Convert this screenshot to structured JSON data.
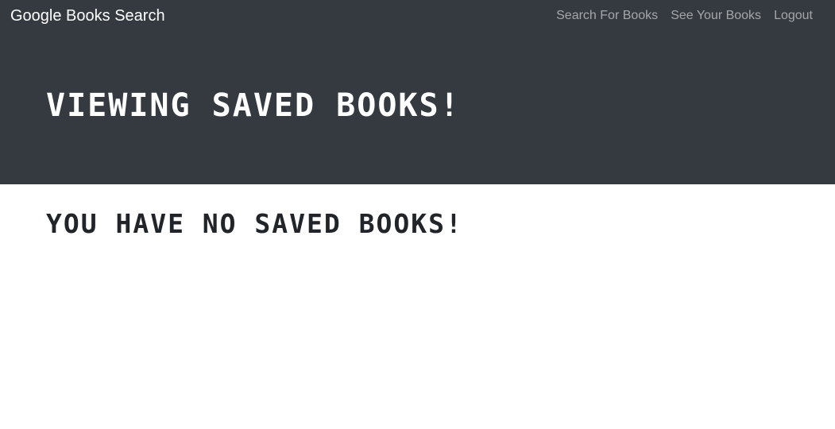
{
  "navbar": {
    "brand": "Google Books Search",
    "links": [
      {
        "label": "Search For Books"
      },
      {
        "label": "See Your Books"
      },
      {
        "label": "Logout"
      }
    ],
    "background": "#343a40"
  },
  "jumbotron": {
    "title": "VIEWING SAVED BOOKS!"
  },
  "main": {
    "message": "YOU HAVE NO SAVED BOOKS!"
  }
}
